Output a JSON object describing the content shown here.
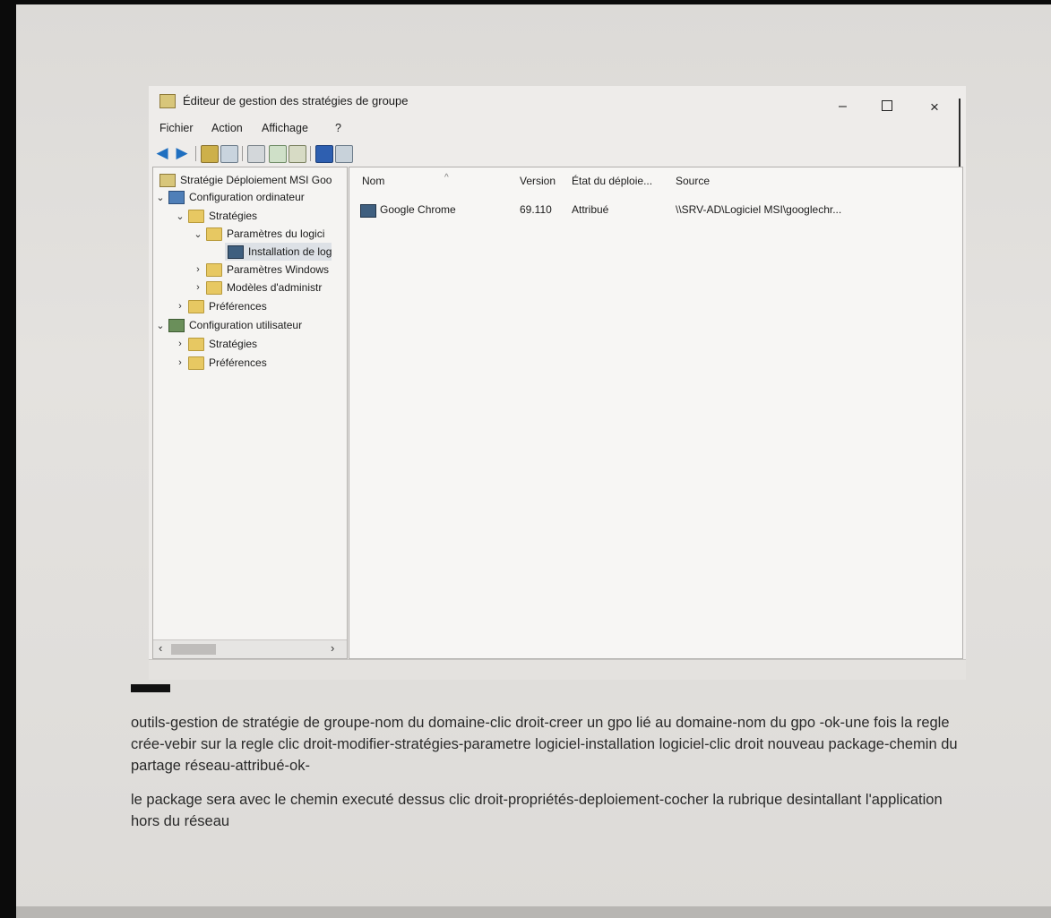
{
  "window": {
    "title": "Éditeur de gestion des stratégies de groupe",
    "controls": {
      "minimize": "–",
      "maximize": "□",
      "close": "×"
    }
  },
  "menu": [
    "Fichier",
    "Action",
    "Affichage",
    "?"
  ],
  "toolbar": {
    "buttons": [
      "back-arrow-icon",
      "forward-arrow-icon",
      "up-folder-icon",
      "show-hide-tree-icon",
      "properties-icon",
      "refresh-icon",
      "export-list-icon",
      "help-icon",
      "view-icon"
    ]
  },
  "tree": {
    "root": "Stratégie Déploiement MSI Goo",
    "computer_config": "Configuration ordinateur",
    "strategies": "Stratégies",
    "software_settings": "Paramètres du logici",
    "software_install": "Installation de log",
    "windows_settings": "Paramètres Windows",
    "admin_templates": "Modèles d'administr",
    "preferences": "Préférences",
    "user_config": "Configuration utilisateur",
    "user_strategies": "Stratégies",
    "user_preferences": "Préférences"
  },
  "list": {
    "columns": [
      "Nom",
      "Version",
      "État du déploie...",
      "Source"
    ],
    "rows": [
      {
        "name": "Google Chrome",
        "version": "69.110",
        "state": "Attribué",
        "source": "\\\\SRV-AD\\Logiciel MSI\\googlechr..."
      }
    ]
  },
  "notes": {
    "paragraph1": "outils-gestion de stratégie de groupe-nom du domaine-clic droit-creer un gpo lié au domaine-nom du gpo -ok-une fois la regle crée-vebir sur la regle clic droit-modifier-stratégies-parametre logiciel-installation logiciel-clic droit nouveau package-chemin du partage réseau-attribué-ok-",
    "paragraph2": "le package sera avec le chemin executé dessus clic droit-propriétés-deploiement-cocher la rubrique desintallant l'application hors du réseau"
  }
}
